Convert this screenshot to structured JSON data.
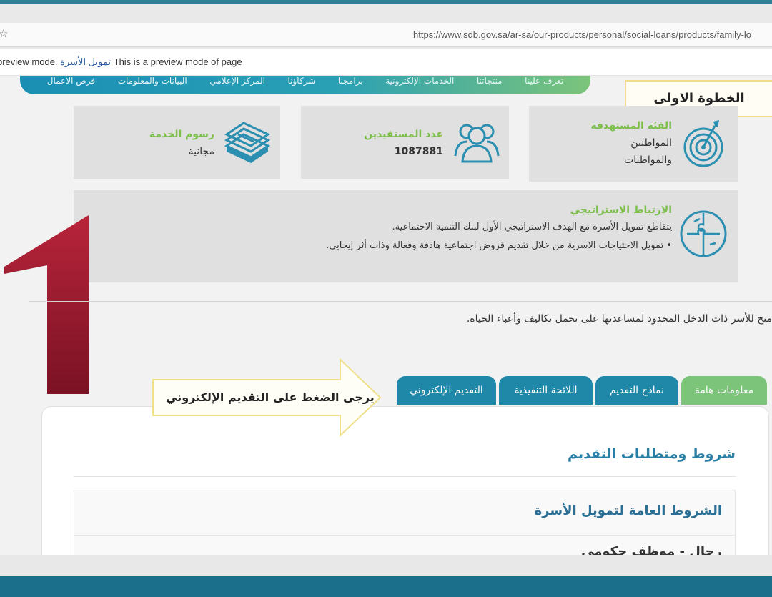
{
  "browser": {
    "url": "https://www.sdb.gov.sa/ar-sa/our-products/personal/social-loans/products/family-lo",
    "preview_prefix": "preview mode.",
    "preview_page_name": "تمويل الأسرة",
    "preview_suffix": "This is a preview mode of page"
  },
  "nav": {
    "items": [
      "تعرف علينا",
      "منتجاتنا",
      "الخدمات الإلكترونية",
      "برامجنا",
      "شركاؤنا",
      "المركز الإعلامي",
      "البيانات والمعلومات",
      "فرص الأعمال"
    ]
  },
  "step_label": "الخطوة الاولى",
  "cards": {
    "target": {
      "label": "الفئة المستهدفة",
      "line1": "المواطنين",
      "line2": "والمواطنات",
      "icon": "target-icon"
    },
    "beneficiaries": {
      "label": "عدد المستفيدين",
      "value": "1087881",
      "icon": "people-icon"
    },
    "fees": {
      "label": "رسوم الخدمة",
      "value": "مجانية",
      "icon": "money-icon"
    }
  },
  "strategic": {
    "label": "الارتباط الاستراتيجي",
    "line1": "يتقاطع تمويل الأسرة مع الهدف الاستراتيجي الأول لبنك التنمية الاجتماعية.",
    "line2": "• تمويل الاحتياجات الاسرية من خلال تقديم قروض اجتماعية هادفة وفعالة وذات أثر إيجابي.",
    "icon": "puzzle-icon"
  },
  "big_number": "1",
  "intro": "منح للأسر ذات الدخل المحدود لمساعدتها على تحمل تكاليف وأعباء الحياة.",
  "tabs": [
    "معلومات هامة",
    "نماذج التقديم",
    "اللائحة التنفيذية",
    "التقديم الإلكتروني"
  ],
  "callout": "يرجى الضغط على التقديم الإلكتروني",
  "content": {
    "section_title": "شروط ومتطلبات التقديم",
    "accordion_title": "الشروط العامة لتمويل الأسرة",
    "accordion_sub": "رجال - موظف حكومي"
  },
  "colors": {
    "accent_blue": "#1b8fb3",
    "accent_green": "#7cc47a",
    "big_one": "#8e1a2c"
  }
}
